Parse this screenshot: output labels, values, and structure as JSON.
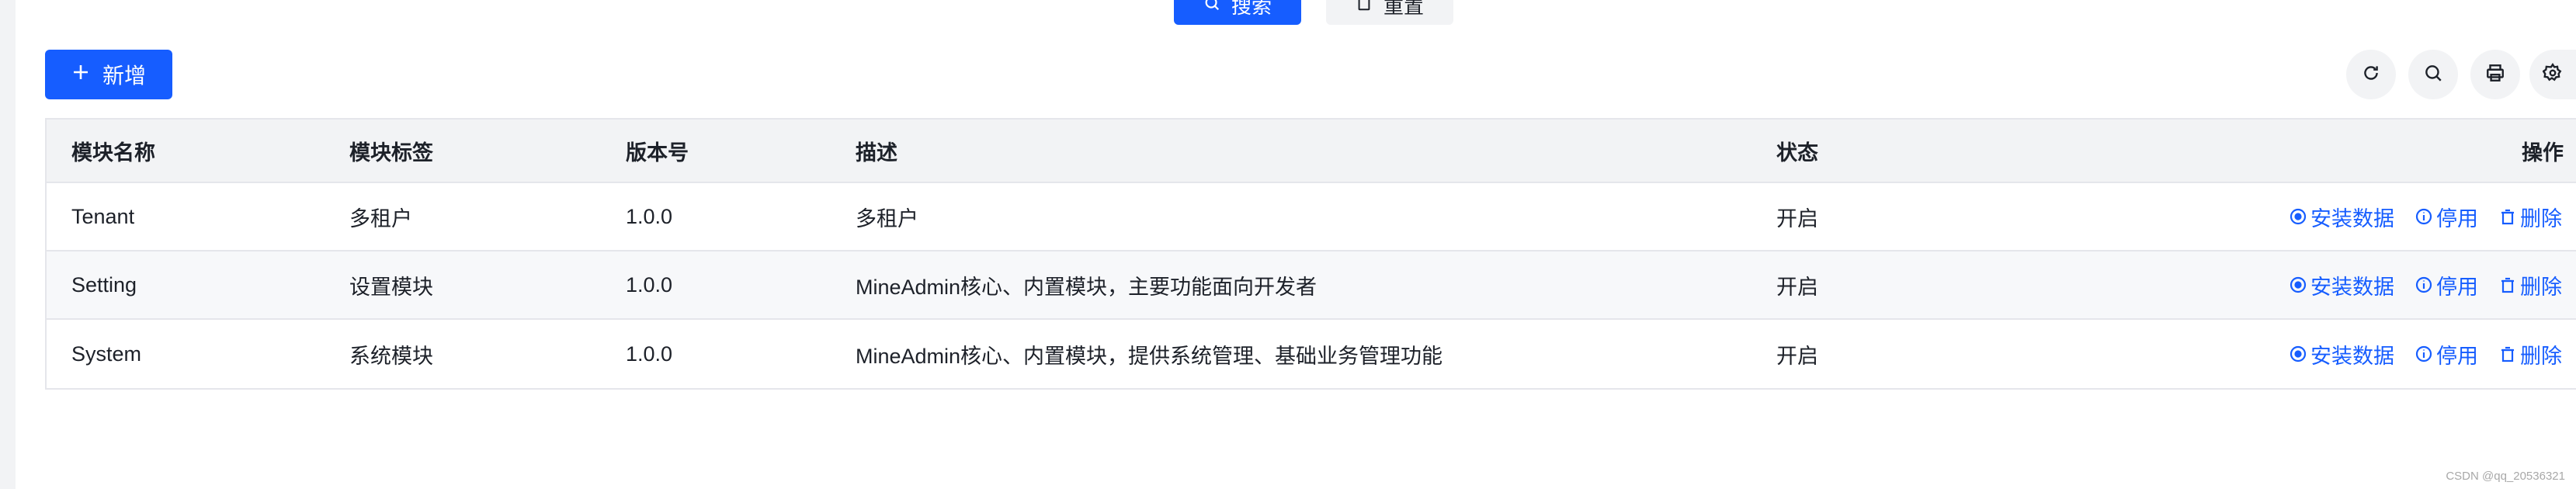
{
  "toolbar": {
    "search_label": "搜索",
    "reset_label": "重置",
    "add_label": "新增"
  },
  "table": {
    "headers": [
      "模块名称",
      "模块标签",
      "版本号",
      "描述",
      "状态",
      "操作"
    ],
    "rows": [
      {
        "name": "Tenant",
        "label": "多租户",
        "version": "1.0.0",
        "description": "多租户",
        "status": "开启"
      },
      {
        "name": "Setting",
        "label": "设置模块",
        "version": "1.0.0",
        "description": "MineAdmin核心、内置模块，主要功能面向开发者",
        "status": "开启"
      },
      {
        "name": "System",
        "label": "系统模块",
        "version": "1.0.0",
        "description": "MineAdmin核心、内置模块，提供系统管理、基础业务管理功能",
        "status": "开启"
      }
    ],
    "actions": {
      "install": "安装数据",
      "disable": "停用",
      "delete": "删除"
    }
  },
  "icons": {
    "add": "plus-icon",
    "search": "search-icon",
    "reset": "clipboard-icon",
    "refresh": "refresh-icon",
    "print": "printer-icon",
    "settings": "gear-icon",
    "install": "dot-circle-icon",
    "disable": "info-circle-icon",
    "delete": "trash-icon"
  },
  "colors": {
    "primary": "#165dff",
    "header_bg": "#f2f3f5",
    "border": "#e5e6eb"
  },
  "watermark": "CSDN @qq_20536321"
}
